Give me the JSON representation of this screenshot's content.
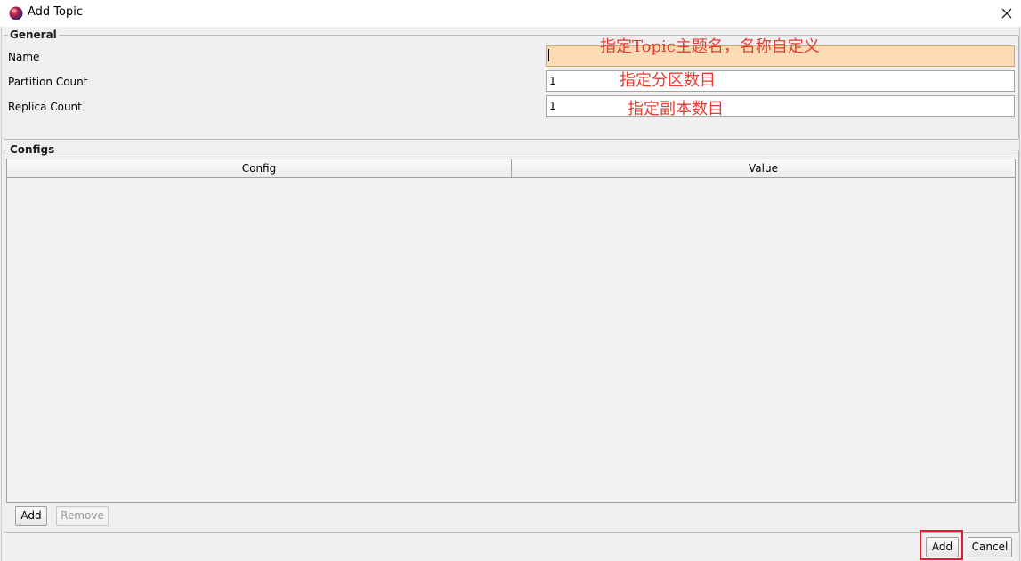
{
  "window": {
    "title": "Add Topic",
    "close_glyph": "✕"
  },
  "general": {
    "legend": "General",
    "fields": [
      {
        "label": "Name",
        "value": "",
        "annotation": "指定Topic主题名，名称自定义"
      },
      {
        "label": "Partition Count",
        "value": "1",
        "annotation": "指定分区数目"
      },
      {
        "label": "Replica Count",
        "value": "1",
        "annotation": "指定副本数目"
      }
    ]
  },
  "configs": {
    "legend": "Configs",
    "columns": [
      "Config",
      "Value"
    ],
    "rows": [],
    "add_label": "Add",
    "remove_label": "Remove"
  },
  "footer": {
    "add_label": "Add",
    "cancel_label": "Cancel"
  },
  "colors": {
    "focused_field": "#fbdbb5",
    "annotation_text": "#e53d30",
    "highlight_border": "#e0202a"
  },
  "icons": {
    "app": "app-logo-icon",
    "close": "close-icon"
  }
}
